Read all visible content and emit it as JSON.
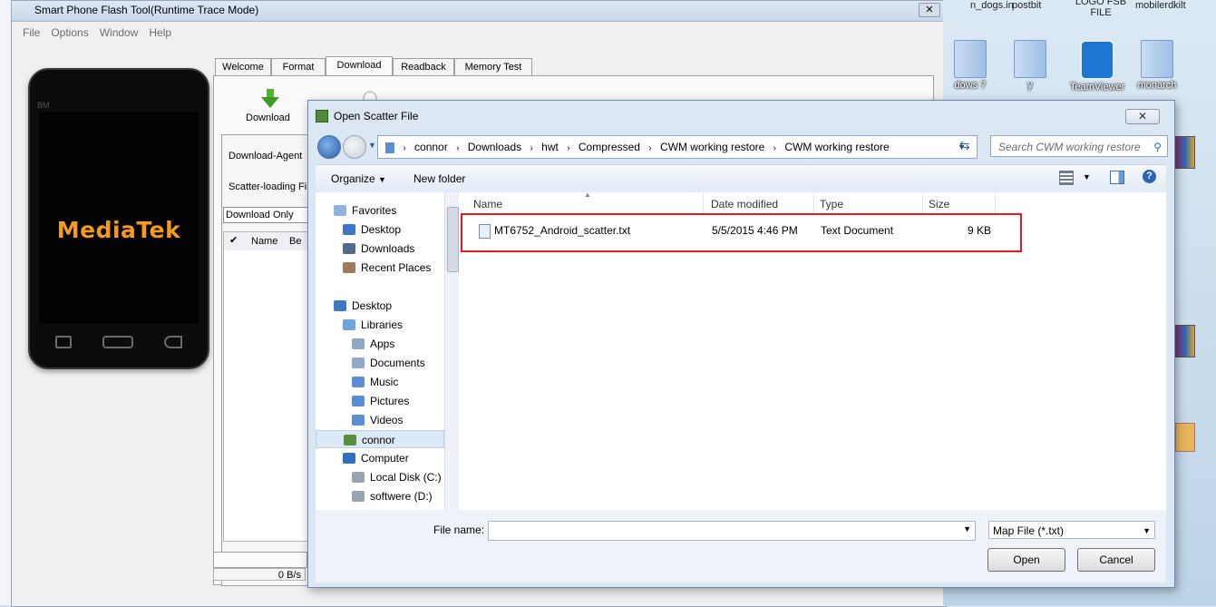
{
  "flash_tool": {
    "title": "Smart Phone Flash Tool(Runtime Trace Mode)",
    "close": "✕",
    "menu": [
      "File",
      "Options",
      "Window",
      "Help"
    ],
    "phone_small_label": "BM",
    "brand": "MediaTek",
    "tabs": [
      "Welcome",
      "Format",
      "Download",
      "Readback",
      "Memory Test"
    ],
    "download_button": "Download",
    "download_agent_label": "Download-Agent",
    "scatter_label": "Scatter-loading Fil",
    "mode_select": "Download Only",
    "grid_headers": [
      "Name",
      "Be"
    ],
    "speed": "0 B/s"
  },
  "dialog": {
    "title": "Open Scatter File",
    "close": "✕",
    "breadcrumb": [
      "connor",
      "Downloads",
      "hwt",
      "Compressed",
      "CWM working restore",
      "CWM working restore"
    ],
    "search_placeholder": "Search CWM working restore",
    "toolbar": {
      "organize": "Organize",
      "new_folder": "New folder"
    },
    "nav": {
      "favorites": "Favorites",
      "favorites_items": [
        "Desktop",
        "Downloads",
        "Recent Places"
      ],
      "desktop": "Desktop",
      "libraries": "Libraries",
      "libraries_items": [
        "Apps",
        "Documents",
        "Music",
        "Pictures",
        "Videos"
      ],
      "user": "connor",
      "computer": "Computer",
      "drives": [
        "Local Disk (C:)",
        "softwere (D:)"
      ]
    },
    "columns": [
      "Name",
      "Date modified",
      "Type",
      "Size"
    ],
    "files": [
      {
        "name": "MT6752_Android_scatter.txt",
        "date": "5/5/2015 4:46 PM",
        "type": "Text Document",
        "size": "9 KB"
      }
    ],
    "file_name_label": "File name:",
    "file_name_value": "",
    "file_type": "Map File (*.txt)",
    "open": "Open",
    "cancel": "Cancel",
    "highlight_color": "#e21b23"
  },
  "desktop_icons": [
    {
      "label": "dows 7",
      "icon": "folder-icon"
    },
    {
      "label": "y",
      "icon": "folder-icon"
    },
    {
      "label": "TeamViewer",
      "icon": "teamviewer-icon"
    },
    {
      "label": "monarch",
      "icon": "folder-icon"
    }
  ],
  "top_labels": [
    "postbit",
    "LOGO FSB FILE",
    "mobilerdkilt",
    "n_dogs.in"
  ]
}
